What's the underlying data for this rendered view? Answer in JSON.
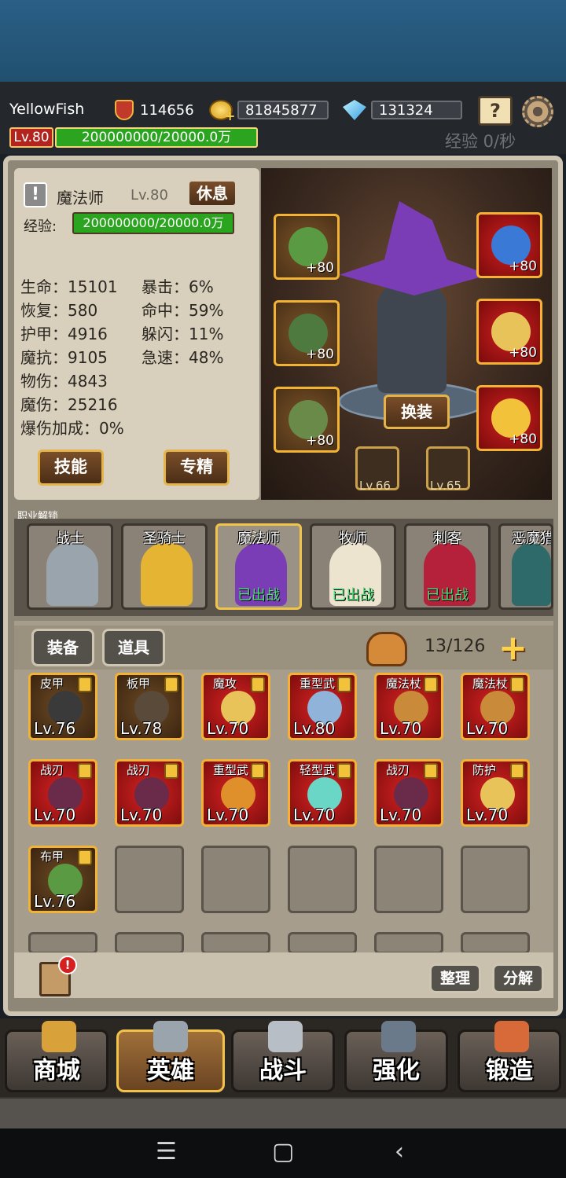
{
  "player": {
    "name": "YellowFish",
    "power": "114656",
    "gold": "81845877",
    "gems": "131324",
    "level": "Lv.80",
    "exp": "200000000/20000.0万",
    "exp_rate": "经验 0/秒"
  },
  "hero": {
    "class_name": "魔法师",
    "level": "Lv.80",
    "rest_label": "休息",
    "exp_label": "经验:",
    "exp_value": "200000000/20000.0万",
    "stats_left": [
      "生命：15101",
      "恢复：580",
      "护甲：4916",
      "魔抗：9105",
      "物伤：4843",
      "魔伤：25216",
      "爆伤加成：0%"
    ],
    "stats_right": [
      "暴击：6%",
      "命中：59%",
      "躲闪：11%",
      "急速：48%"
    ],
    "skill_label": "技能",
    "spec_label": "专精",
    "swap_label": "换装",
    "equip_plus": [
      "+80",
      "+80",
      "+80",
      "+80",
      "+80",
      "+80"
    ],
    "gem_levels": [
      "Lv.66",
      "Lv.65"
    ]
  },
  "jobs": {
    "label": "职业解锁",
    "items": [
      {
        "name": "战士",
        "status": ""
      },
      {
        "name": "圣骑士",
        "status": ""
      },
      {
        "name": "魔法师",
        "status": "已出战"
      },
      {
        "name": "牧师",
        "status": "已出战"
      },
      {
        "name": "刺客",
        "status": "已出战"
      },
      {
        "name": "恶魔猎",
        "status": ""
      }
    ]
  },
  "inventory": {
    "tabs": [
      "装备",
      "道具"
    ],
    "count": "13/126",
    "items": [
      {
        "name": "皮甲",
        "level": "Lv.76",
        "rarity": "gold"
      },
      {
        "name": "板甲",
        "level": "Lv.78",
        "rarity": "gold"
      },
      {
        "name": "魔攻",
        "level": "Lv.70",
        "rarity": "red"
      },
      {
        "name": "重型武",
        "level": "Lv.80",
        "rarity": "red"
      },
      {
        "name": "魔法杖",
        "level": "Lv.70",
        "rarity": "red"
      },
      {
        "name": "魔法杖",
        "level": "Lv.70",
        "rarity": "red"
      },
      {
        "name": "战刃",
        "level": "Lv.70",
        "rarity": "red"
      },
      {
        "name": "战刃",
        "level": "Lv.70",
        "rarity": "red"
      },
      {
        "name": "重型武",
        "level": "Lv.70",
        "rarity": "red"
      },
      {
        "name": "轻型武",
        "level": "Lv.70",
        "rarity": "red"
      },
      {
        "name": "战刃",
        "level": "Lv.70",
        "rarity": "red"
      },
      {
        "name": "防护",
        "level": "Lv.70",
        "rarity": "red"
      },
      {
        "name": "布甲",
        "level": "Lv.76",
        "rarity": "gold"
      }
    ],
    "sort_label": "整理",
    "decompose_label": "分解",
    "log_alert": "!"
  },
  "nav": [
    "商城",
    "英雄",
    "战斗",
    "强化",
    "锻造"
  ],
  "system": {
    "menu": "☰",
    "home": "▢",
    "back": "‹"
  }
}
